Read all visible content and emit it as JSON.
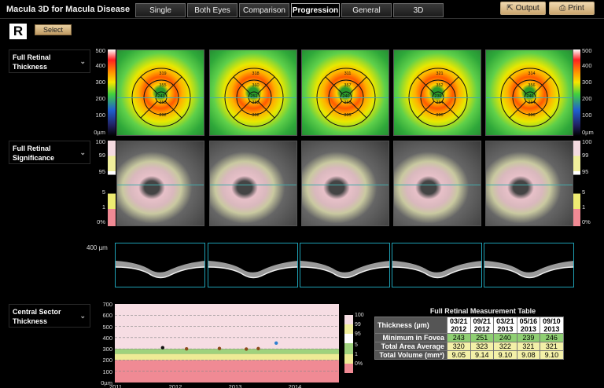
{
  "app_title": "Macula 3D for Macula Disease",
  "tabs": [
    {
      "label": "Single"
    },
    {
      "label": "Both Eyes"
    },
    {
      "label": "Comparison"
    },
    {
      "label": "Progression"
    },
    {
      "label": "General"
    },
    {
      "label": "3D"
    }
  ],
  "active_tab": "Progression",
  "actions": {
    "output_label": "Output",
    "print_label": "Print"
  },
  "eye_label": "R",
  "select_label": "Select",
  "sections": {
    "thickness": "Full Retinal Thickness",
    "significance": "Full Retinal Significance",
    "central": "Central Sector Thickness"
  },
  "thickness_scale": [
    "500",
    "400",
    "300",
    "200",
    "100",
    "0µm"
  ],
  "significance_scale": [
    "100",
    "99",
    "95",
    "5",
    "1",
    "0%"
  ],
  "maps": [
    {
      "top": "319",
      "center": "243",
      "inner_top": "355",
      "inner_bottom": "358",
      "bottom": "292",
      "left": "265",
      "right": "297"
    },
    {
      "top": "318",
      "center": "251",
      "inner_top": "360",
      "inner_bottom": "382",
      "bottom": "302",
      "left": "",
      "right": ""
    },
    {
      "top": "311",
      "center": "240",
      "inner_top": "357",
      "inner_bottom": "366",
      "bottom": "305",
      "left": "",
      "right": ""
    },
    {
      "top": "321",
      "center": "239",
      "inner_top": "352",
      "inner_bottom": "354",
      "bottom": "300",
      "left": "",
      "right": ""
    },
    {
      "top": "314",
      "center": "246",
      "inner_top": "356",
      "inner_bottom": "364",
      "bottom": "300",
      "left": "",
      "right": ""
    }
  ],
  "bscan_scale": "400 µm",
  "chart_data": {
    "type": "scatter",
    "y_ticks": [
      "700",
      "600",
      "500",
      "400",
      "300",
      "200",
      "100",
      "0µm"
    ],
    "x_ticks": [
      "2011",
      "2012",
      "2013",
      "2014"
    ],
    "ylim": [
      0,
      700
    ],
    "xlim": [
      2011,
      2014.75
    ],
    "bands": [
      {
        "from": 0,
        "to": 200,
        "color": "#f08a94"
      },
      {
        "from": 200,
        "to": 255,
        "color": "#eeeb95"
      },
      {
        "from": 255,
        "to": 300,
        "color": "#9fd27d"
      },
      {
        "from": 300,
        "to": 700,
        "color": "#f6dde3"
      }
    ],
    "points": [
      {
        "x": 2011.8,
        "y": 310,
        "color": "#111111"
      },
      {
        "x": 2012.2,
        "y": 300,
        "color": "#8b4a1c"
      },
      {
        "x": 2012.75,
        "y": 303,
        "color": "#8b4a1c"
      },
      {
        "x": 2013.2,
        "y": 298,
        "color": "#8b4a1c"
      },
      {
        "x": 2013.4,
        "y": 302,
        "color": "#8b4a1c"
      },
      {
        "x": 2013.7,
        "y": 351,
        "color": "#2f7fd0"
      }
    ]
  },
  "legend_scale": [
    "100",
    "99",
    "95",
    "5",
    "1",
    "0%"
  ],
  "table": {
    "title": "Full Retinal Measurement Table",
    "header_label": "Thickness (µm)",
    "dates": [
      {
        "d": "03/21",
        "y": "2012"
      },
      {
        "d": "09/21",
        "y": "2012"
      },
      {
        "d": "03/21",
        "y": "2013"
      },
      {
        "d": "05/16",
        "y": "2013"
      },
      {
        "d": "09/10",
        "y": "2013"
      }
    ],
    "rows": [
      {
        "label": "Minimum in Fovea",
        "values": [
          "243",
          "251",
          "240",
          "239",
          "246"
        ],
        "class": "g"
      },
      {
        "label": "Total Area Average",
        "values": [
          "320",
          "323",
          "322",
          "321",
          "321"
        ],
        "class": "y"
      },
      {
        "label": "Total Volume (mm³)",
        "values": [
          "9.05",
          "9.14",
          "9.10",
          "9.08",
          "9.10"
        ],
        "class": "y"
      }
    ]
  },
  "colors": {
    "accent": "#1ea0b4",
    "button": "#caa56e"
  }
}
